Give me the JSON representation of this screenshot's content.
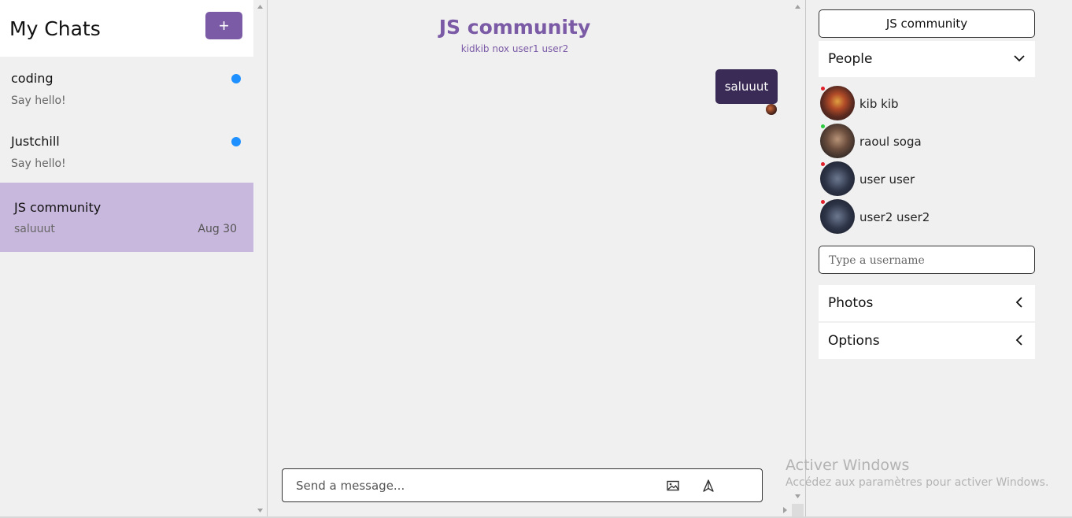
{
  "sidebar": {
    "title": "My Chats",
    "new_chat_label": "+",
    "chats": [
      {
        "name": "coding",
        "preview": "Say hello!",
        "date": "",
        "unread": true
      },
      {
        "name": "Justchill",
        "preview": "Say hello!",
        "date": "",
        "unread": true
      },
      {
        "name": "JS community",
        "preview": "saluuut",
        "date": "Aug 30",
        "active": true
      }
    ]
  },
  "conversation": {
    "title": "JS community",
    "members": "kidkib nox user1 user2",
    "messages": [
      {
        "text": "saluuut",
        "own": true
      }
    ],
    "composer_placeholder": "Send a message...",
    "attach_image_icon": "image-icon",
    "send_icon": "send-icon"
  },
  "details": {
    "room_name": "JS community",
    "people_label": "People",
    "people": [
      {
        "name": "kib kib",
        "online": false
      },
      {
        "name": "raoul soga",
        "online": true
      },
      {
        "name": "user user",
        "online": false
      },
      {
        "name": "user2 user2",
        "online": false
      }
    ],
    "username_placeholder": "Type a username",
    "photos_label": "Photos",
    "options_label": "Options"
  },
  "watermark": {
    "title": "Activer Windows",
    "subtitle": "Accédez aux paramètres pour activer Windows."
  },
  "colors": {
    "accent": "#7b5aa6",
    "bubble": "#3a2a56",
    "active_chat": "#c9b8dd",
    "unread_dot": "#1e90ff",
    "online": "#2ecc40",
    "offline": "#e0202a"
  }
}
